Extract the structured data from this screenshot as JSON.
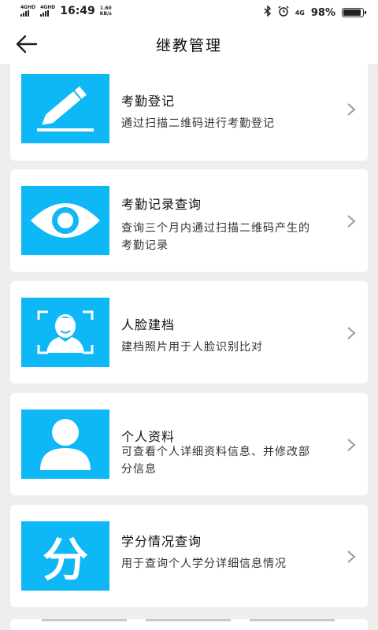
{
  "status_bar": {
    "signal1": "4GHD",
    "signal2": "4GHD",
    "time": "16:49",
    "speed_value": "1.60",
    "speed_unit": "KB/s",
    "network": "4G",
    "battery": "98%",
    "battery_level": 0.98
  },
  "header": {
    "title": "继教管理",
    "back_icon": "back-arrow-icon"
  },
  "items": [
    {
      "title": "考勤登记",
      "desc": "通过扫描二维码进行考勤登记",
      "icon": "pencil-icon"
    },
    {
      "title": "考勤记录查询",
      "desc": "查询三个月内通过扫描二维码产生的考勤记录",
      "icon": "eye-icon"
    },
    {
      "title": "人脸建档",
      "desc": "建档照片用于人脸识别比对",
      "icon": "face-scan-icon"
    },
    {
      "title": "个人资料",
      "desc": "可查看个人详细资料信息、并修改部分信息",
      "icon": "person-icon"
    },
    {
      "title": "学分情况查询",
      "desc": "用于查询个人学分详细信息情况",
      "icon": "credit-fen-icon",
      "icon_glyph": "分"
    }
  ],
  "colors": {
    "accent": "#0eb7f5",
    "background": "#efeeec",
    "card": "#ffffff"
  }
}
